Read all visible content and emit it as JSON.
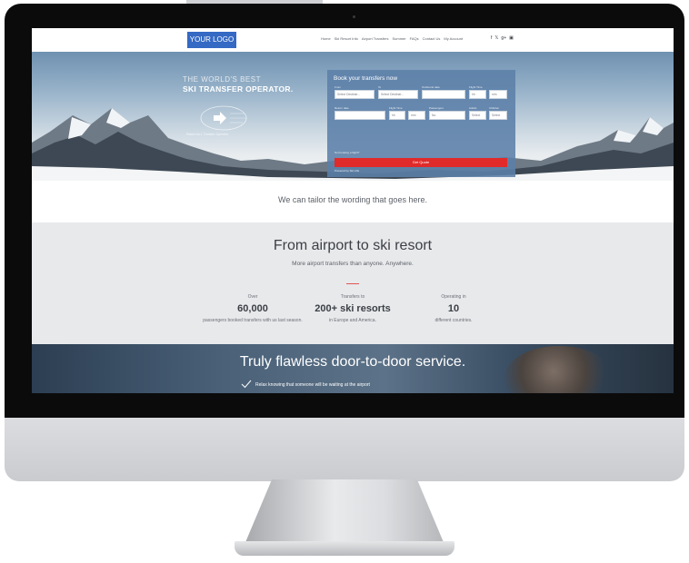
{
  "nav": {
    "logo": "YOUR LOGO",
    "menu": [
      "Home",
      "Ski Resort Info",
      "Airport Transfers",
      "Summer",
      "FAQs",
      "Contact Us",
      "My Account"
    ],
    "social_icons": [
      "facebook-icon",
      "twitter-icon",
      "google-plus-icon",
      "instagram-icon"
    ]
  },
  "hero": {
    "kicker": "THE WORLD'S BEST",
    "title": "SKI TRANSFER OPERATOR.",
    "badge_text": "Rated No.1 Transfer Operator"
  },
  "booking": {
    "title": "Book your transfers now",
    "fields": {
      "from_label": "From",
      "from_value": "Select Destinat...",
      "to_label": "To",
      "to_value": "Select Destinat...",
      "outbound_label": "Outbound date",
      "flight_time_label": "Flight Time",
      "hh": "hh",
      "mm": "mm",
      "return_label": "Return date",
      "return_flight_label": "Flight Time",
      "pax_label": "Passengers",
      "pax_value": "No.",
      "adults_label": "Adults",
      "children_label": "Children",
      "select": "Select"
    },
    "link": "Not booking a flight?",
    "button": "Get Quote",
    "footer": "Powered by Ski Lifts"
  },
  "tagline": "We can tailor the wording that goes here.",
  "stats": {
    "title": "From airport to ski resort",
    "subtitle": "More airport transfers than anyone. Anywhere.",
    "items": [
      {
        "pre": "Over",
        "main": "60,000",
        "post": "passengers booked transfers with us last season."
      },
      {
        "pre": "Transfers to",
        "main": "200+ ski resorts",
        "post": "in Europe and America."
      },
      {
        "pre": "Operating in",
        "main": "10",
        "post": "different countries."
      }
    ]
  },
  "service": {
    "title": "Truly flawless door-to-door service.",
    "line": "Relax knowing that someone will be waiting at the airport"
  },
  "colors": {
    "logo_bg": "#3469c4",
    "cta_red": "#e12a2a",
    "booking_panel": "#5c80a8",
    "stats_bg": "#e8e9eb"
  }
}
